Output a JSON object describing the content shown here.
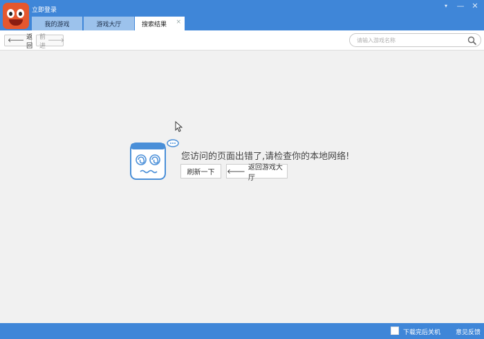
{
  "titlebar": {
    "login_link": "立即登录",
    "tabs": [
      {
        "label": "我的游戏",
        "active": false
      },
      {
        "label": "游戏大厅",
        "active": false
      },
      {
        "label": "搜索结果",
        "active": true
      }
    ],
    "tab_close_glyph": "×",
    "window_controls": {
      "menu": "▾",
      "minimize": "—",
      "close": "✕"
    }
  },
  "toolbar": {
    "back_label": "返回",
    "forward_label": "前进",
    "search": {
      "placeholder": "请输入游戏名称",
      "value": ""
    }
  },
  "main": {
    "error_message": "您访问的页面出错了,请检查你的本地网络!",
    "refresh_label": "刷新一下",
    "return_label": "返回游戏大厅"
  },
  "statusbar": {
    "shutdown_label": "下载完后关机",
    "shutdown_checked": false,
    "feedback_label": "意见反馈"
  },
  "colors": {
    "brand_blue": "#3f86d8",
    "inactive_tab": "#9cc2ec",
    "mascot_blue": "#4a8fd8",
    "logo_orange": "#e4572e"
  },
  "icons": [
    "app-logo-icon",
    "arrow-left-icon",
    "arrow-right-icon",
    "search-icon",
    "dizzy-mascot-icon",
    "mouse-cursor-icon"
  ]
}
